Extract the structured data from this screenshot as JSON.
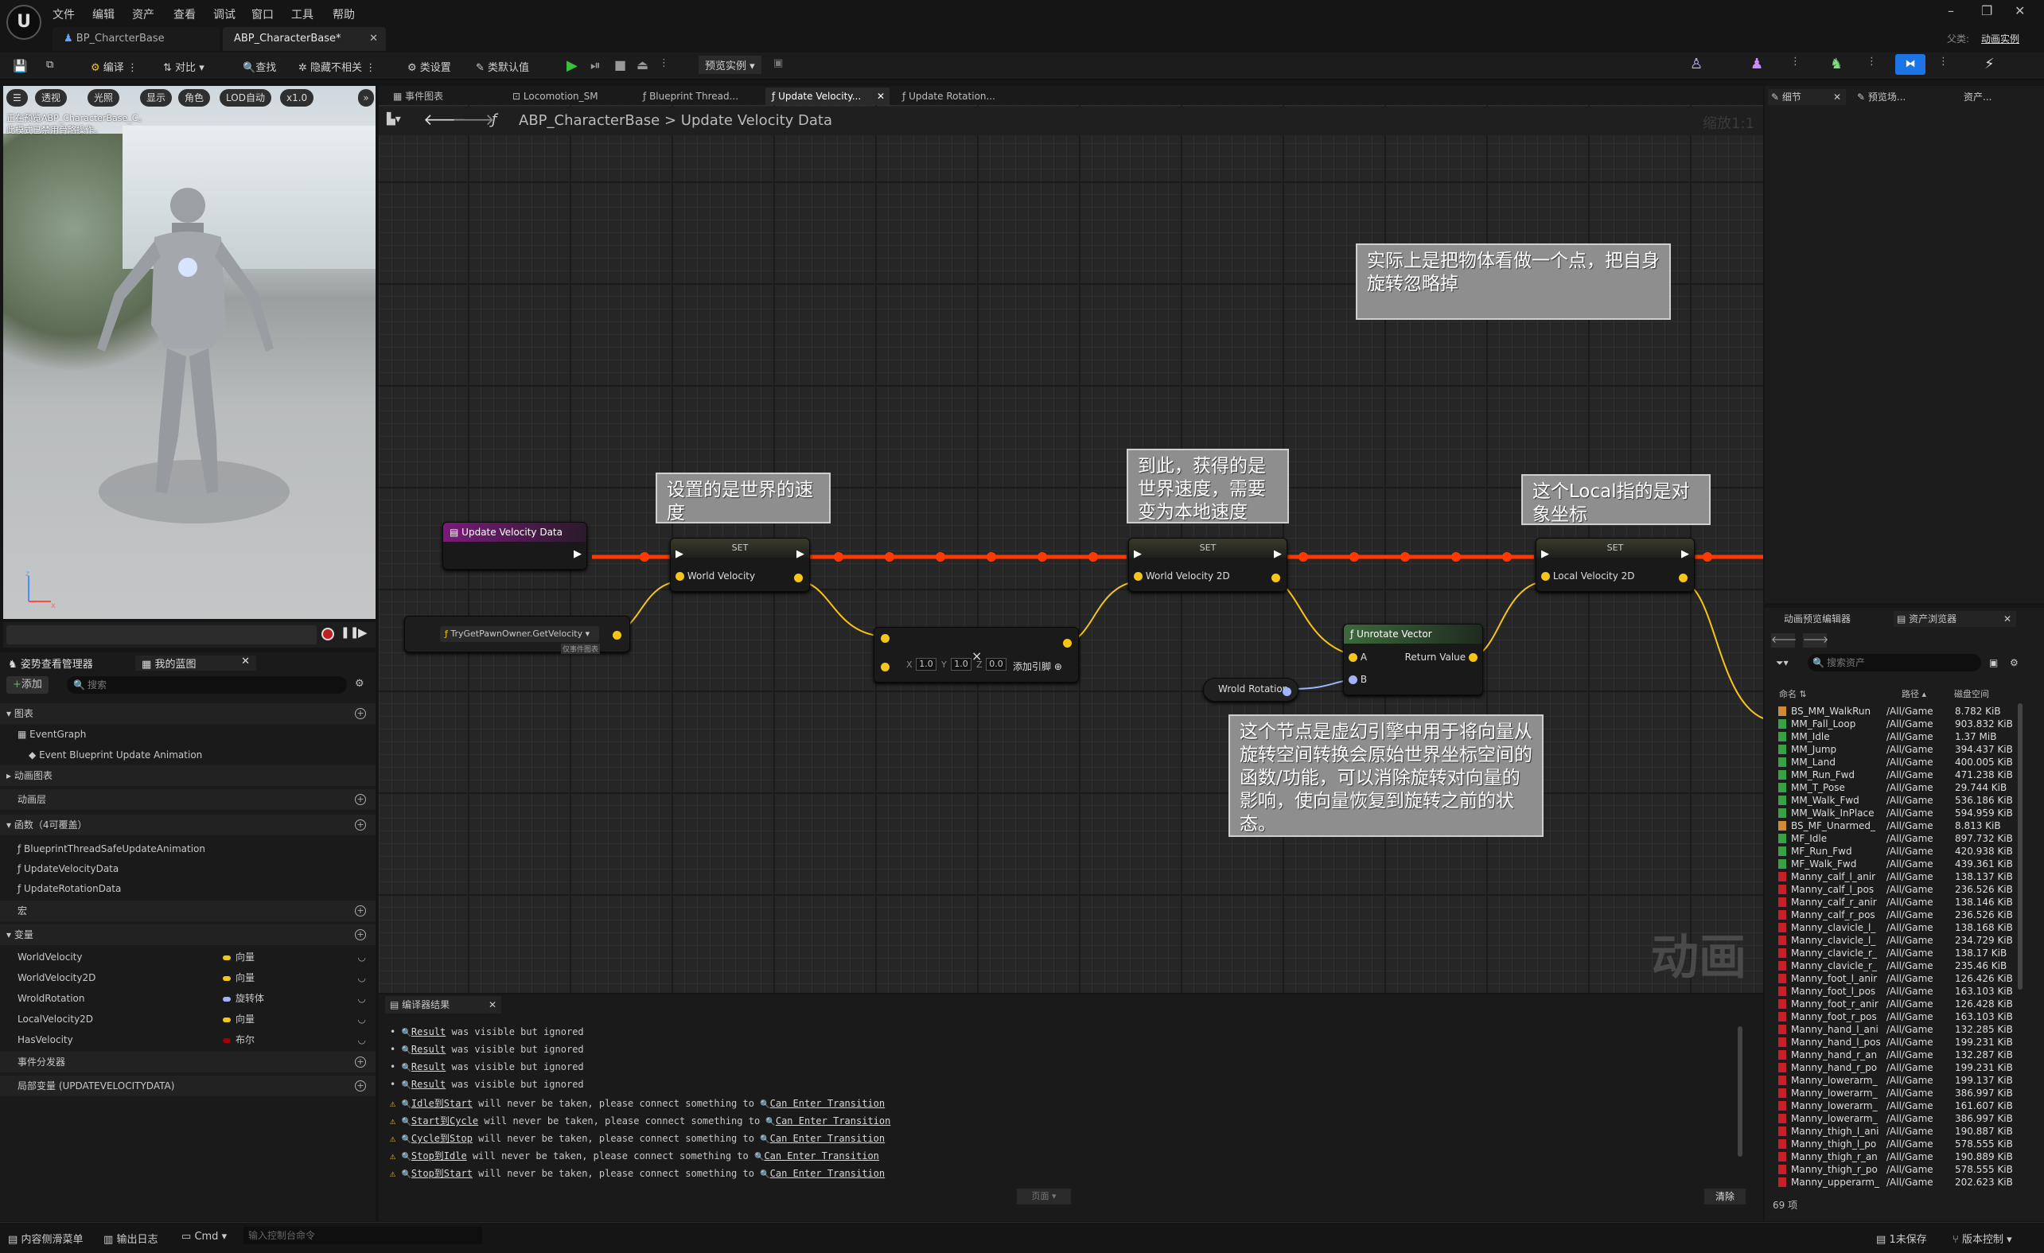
{
  "menubar": {
    "items": [
      "文件",
      "编辑",
      "资产",
      "查看",
      "调试",
      "窗口",
      "工具",
      "帮助"
    ],
    "parent_label": "父类:",
    "parent_value": "动画实例"
  },
  "tabs": [
    {
      "label": "BP_CharcterBase"
    },
    {
      "label": "ABP_CharacterBase*"
    }
  ],
  "toolbar": {
    "compile": "编译",
    "diff": "对比",
    "find": "查找",
    "hide_unrelated": "隐藏不相关",
    "class_settings": "类设置",
    "class_defaults": "类默认值",
    "preview_instance": "预览实例"
  },
  "viewport": {
    "buttons": [
      "透视",
      "光照",
      "显示",
      "角色",
      "LOD自动",
      "x1.0"
    ],
    "note_line1": "正在预览ABP_CharacterBase_C。",
    "note_line2": "此模式已禁用骨骼操作。"
  },
  "left_panel": {
    "tab1": "姿势查看管理器",
    "tab2": "我的蓝图",
    "add_label": "添加",
    "search_placeholder": "搜索",
    "sections": {
      "graphs": "图表",
      "anim_graphs": "动画图表",
      "anim_layers": "动画层",
      "functions": "函数（4可覆盖）",
      "macros": "宏",
      "variables": "变量",
      "dispatchers": "事件分发器",
      "locals": "局部变量 (UPDATEVELOCITYDATA)"
    },
    "event_graph": "EventGraph",
    "event_item": "Event Blueprint Update Animation",
    "functions": [
      "BlueprintThreadSafeUpdateAnimation",
      "UpdateVelocityData",
      "UpdateRotationData"
    ],
    "variables": [
      {
        "name": "WorldVelocity",
        "type": "向量",
        "color": "#f5c518"
      },
      {
        "name": "WorldVelocity2D",
        "type": "向量",
        "color": "#f5c518"
      },
      {
        "name": "WroldRotation",
        "type": "旋转体",
        "color": "#9fb3ff"
      },
      {
        "name": "LocalVelocity2D",
        "type": "向量",
        "color": "#f5c518"
      },
      {
        "name": "HasVelocity",
        "type": "布尔",
        "color": "#a30000"
      }
    ]
  },
  "graph_tabs": [
    "事件图表",
    "Locomotion_SM",
    "Blueprint Thread...",
    "Update Velocity...",
    "Update Rotation..."
  ],
  "breadcrumb": {
    "root": "ABP_CharacterBase",
    "sep": ">",
    "current": "Update Velocity Data",
    "zoom": "缩放1:1"
  },
  "nodes": {
    "entry": "Update Velocity Data",
    "set": "SET",
    "world_velocity": "World Velocity",
    "world_velocity_2d": "World Velocity 2D",
    "local_velocity_2d": "Local Velocity 2D",
    "get_velocity": "TryGetPawnOwner.GetVelocity",
    "thread_unsafe": "仅事件图表",
    "make_x": "1.0",
    "make_y": "1.0",
    "make_z": "0.0",
    "add_pin": "添加引脚",
    "unrotate": "Unrotate Vector",
    "pin_a": "A",
    "pin_b": "B",
    "return_value": "Return Value",
    "wrold_rotation": "Wrold Rotation"
  },
  "comments": {
    "c1": "实际上是把物体看做一个点，把自身旋转忽略掉",
    "c2": "设置的是世界的速度",
    "c3": "到此，获得的是世界速度，需要变为本地速度",
    "c4": "这个Local指的是对象坐标",
    "c5": "这个节点是虚幻引擎中用于将向量从旋转空间转换会原始世界坐标空间的函数/功能，可以消除旋转对向量的影响，使向量恢复到旋转之前的状态。"
  },
  "watermark": "动画",
  "compiler": {
    "title": "编译器结果",
    "lines": [
      {
        "kind": "bullet",
        "link": "Result",
        "text": " was visible but ignored"
      },
      {
        "kind": "bullet",
        "link": "Result",
        "text": " was visible but ignored"
      },
      {
        "kind": "bullet",
        "link": "Result",
        "text": " was visible but ignored"
      },
      {
        "kind": "bullet",
        "link": "Result",
        "text": " was visible but ignored"
      },
      {
        "kind": "warn",
        "link": "Idle到Start",
        "text": " will never be taken, please connect something to ",
        "link2": "Can Enter Transition"
      },
      {
        "kind": "warn",
        "link": "Start到Cycle",
        "text": " will never be taken, please connect something to ",
        "link2": "Can Enter Transition"
      },
      {
        "kind": "warn",
        "link": "Cycle到Stop",
        "text": " will never be taken, please connect something to ",
        "link2": "Can Enter Transition"
      },
      {
        "kind": "warn",
        "link": "Stop到Idle",
        "text": " will never be taken, please connect something to ",
        "link2": "Can Enter Transition"
      },
      {
        "kind": "warn",
        "link": "Stop到Start",
        "text": " will never be taken, please connect something to ",
        "link2": "Can Enter Transition"
      }
    ],
    "page_label": "页面",
    "clear_label": "清除"
  },
  "right_panel": {
    "details": "细节",
    "preview_scene": "预览场...",
    "asset_details": "资产...",
    "anim_preview_editor": "动画预览编辑器",
    "asset_browser": "资产浏览器",
    "search_placeholder": "搜索资产",
    "col_name": "命名",
    "col_path": "路径",
    "col_disk": "磁盘空间",
    "count": "69 项"
  },
  "assets": [
    {
      "name": "BS_MM_WalkRun",
      "path": "/All/Game",
      "size": "8.782 KiB",
      "color": "#d08a3a"
    },
    {
      "name": "MM_Fall_Loop",
      "path": "/All/Game",
      "size": "903.832 KiB",
      "color": "#3aa04a"
    },
    {
      "name": "MM_Idle",
      "path": "/All/Game",
      "size": "1.37 MiB",
      "color": "#3aa04a"
    },
    {
      "name": "MM_Jump",
      "path": "/All/Game",
      "size": "394.437 KiB",
      "color": "#3aa04a"
    },
    {
      "name": "MM_Land",
      "path": "/All/Game",
      "size": "400.005 KiB",
      "color": "#3aa04a"
    },
    {
      "name": "MM_Run_Fwd",
      "path": "/All/Game",
      "size": "471.238 KiB",
      "color": "#3aa04a"
    },
    {
      "name": "MM_T_Pose",
      "path": "/All/Game",
      "size": "29.744 KiB",
      "color": "#3aa04a"
    },
    {
      "name": "MM_Walk_Fwd",
      "path": "/All/Game",
      "size": "536.186 KiB",
      "color": "#3aa04a"
    },
    {
      "name": "MM_Walk_InPlace",
      "path": "/All/Game",
      "size": "594.959 KiB",
      "color": "#3aa04a"
    },
    {
      "name": "BS_MF_Unarmed_",
      "path": "/All/Game",
      "size": "8.813 KiB",
      "color": "#d08a3a"
    },
    {
      "name": "MF_Idle",
      "path": "/All/Game",
      "size": "897.732 KiB",
      "color": "#3aa04a"
    },
    {
      "name": "MF_Run_Fwd",
      "path": "/All/Game",
      "size": "420.938 KiB",
      "color": "#3aa04a"
    },
    {
      "name": "MF_Walk_Fwd",
      "path": "/All/Game",
      "size": "439.361 KiB",
      "color": "#3aa04a"
    },
    {
      "name": "Manny_calf_l_anir",
      "path": "/All/Game",
      "size": "138.137 KiB",
      "color": "#c8202a"
    },
    {
      "name": "Manny_calf_l_pos",
      "path": "/All/Game",
      "size": "236.526 KiB",
      "color": "#c8202a"
    },
    {
      "name": "Manny_calf_r_anir",
      "path": "/All/Game",
      "size": "138.146 KiB",
      "color": "#c8202a"
    },
    {
      "name": "Manny_calf_r_pos",
      "path": "/All/Game",
      "size": "236.526 KiB",
      "color": "#c8202a"
    },
    {
      "name": "Manny_clavicle_l_",
      "path": "/All/Game",
      "size": "138.168 KiB",
      "color": "#c8202a"
    },
    {
      "name": "Manny_clavicle_l_",
      "path": "/All/Game",
      "size": "234.729 KiB",
      "color": "#c8202a"
    },
    {
      "name": "Manny_clavicle_r_",
      "path": "/All/Game",
      "size": "138.17 KiB",
      "color": "#c8202a"
    },
    {
      "name": "Manny_clavicle_r_",
      "path": "/All/Game",
      "size": "235.46 KiB",
      "color": "#c8202a"
    },
    {
      "name": "Manny_foot_l_anir",
      "path": "/All/Game",
      "size": "126.426 KiB",
      "color": "#c8202a"
    },
    {
      "name": "Manny_foot_l_pos",
      "path": "/All/Game",
      "size": "163.103 KiB",
      "color": "#c8202a"
    },
    {
      "name": "Manny_foot_r_anir",
      "path": "/All/Game",
      "size": "126.428 KiB",
      "color": "#c8202a"
    },
    {
      "name": "Manny_foot_r_pos",
      "path": "/All/Game",
      "size": "163.103 KiB",
      "color": "#c8202a"
    },
    {
      "name": "Manny_hand_l_ani",
      "path": "/All/Game",
      "size": "132.285 KiB",
      "color": "#c8202a"
    },
    {
      "name": "Manny_hand_l_pos",
      "path": "/All/Game",
      "size": "199.231 KiB",
      "color": "#c8202a"
    },
    {
      "name": "Manny_hand_r_an",
      "path": "/All/Game",
      "size": "132.287 KiB",
      "color": "#c8202a"
    },
    {
      "name": "Manny_hand_r_po",
      "path": "/All/Game",
      "size": "199.231 KiB",
      "color": "#c8202a"
    },
    {
      "name": "Manny_lowerarm_",
      "path": "/All/Game",
      "size": "199.137 KiB",
      "color": "#c8202a"
    },
    {
      "name": "Manny_lowerarm_",
      "path": "/All/Game",
      "size": "386.997 KiB",
      "color": "#c8202a"
    },
    {
      "name": "Manny_lowerarm_",
      "path": "/All/Game",
      "size": "161.607 KiB",
      "color": "#c8202a"
    },
    {
      "name": "Manny_lowerarm_",
      "path": "/All/Game",
      "size": "386.997 KiB",
      "color": "#c8202a"
    },
    {
      "name": "Manny_thigh_l_ani",
      "path": "/All/Game",
      "size": "190.887 KiB",
      "color": "#c8202a"
    },
    {
      "name": "Manny_thigh_l_po",
      "path": "/All/Game",
      "size": "578.555 KiB",
      "color": "#c8202a"
    },
    {
      "name": "Manny_thigh_r_an",
      "path": "/All/Game",
      "size": "190.889 KiB",
      "color": "#c8202a"
    },
    {
      "name": "Manny_thigh_r_po",
      "path": "/All/Game",
      "size": "578.555 KiB",
      "color": "#c8202a"
    },
    {
      "name": "Manny_upperarm_",
      "path": "/All/Game",
      "size": "202.623 KiB",
      "color": "#c8202a"
    }
  ],
  "statusbar": {
    "content_drawer": "内容侧滑菜单",
    "output_log": "输出日志",
    "cmd": "Cmd",
    "cmd_placeholder": "输入控制台命令",
    "unsaved": "1未保存",
    "source_control": "版本控制"
  }
}
